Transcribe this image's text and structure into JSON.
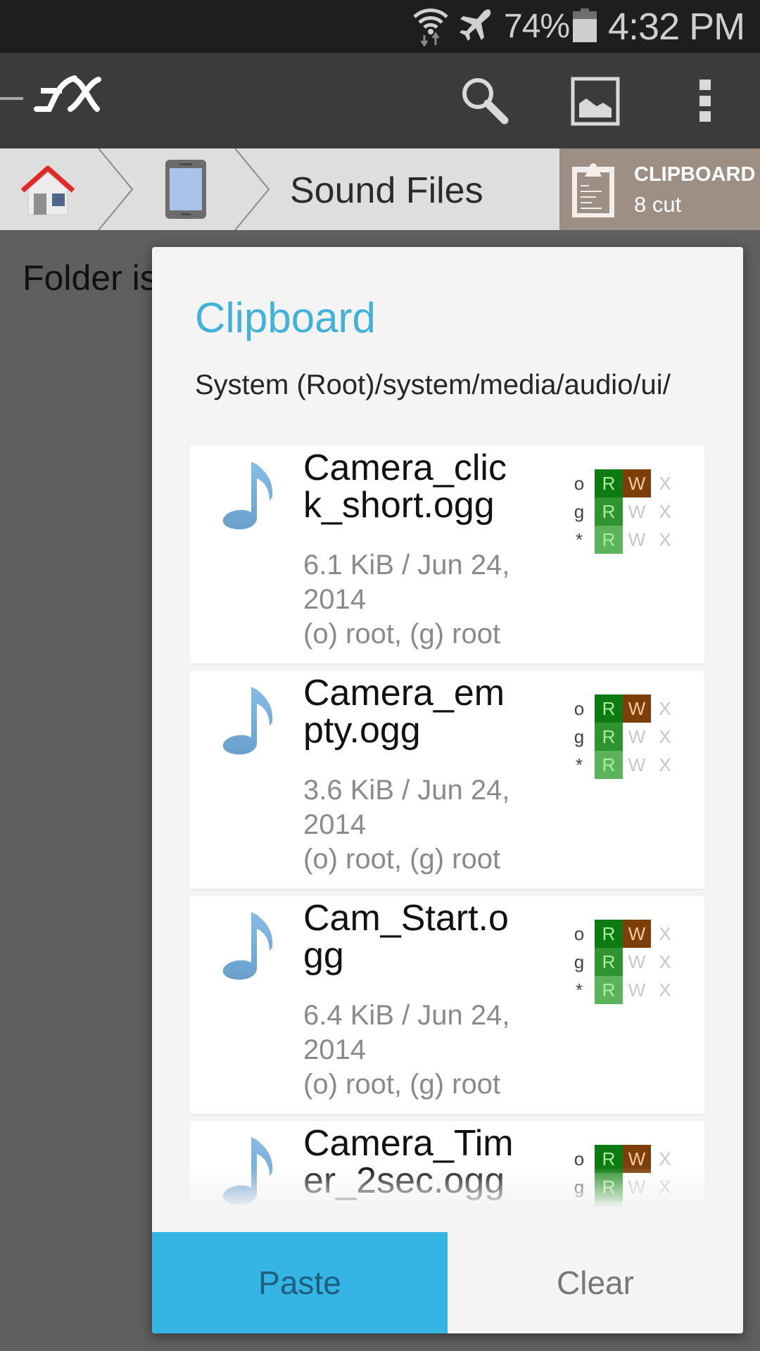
{
  "status_bar": {
    "battery_percent": "74%",
    "battery_level": 0.74,
    "time": "4:32 PM",
    "icons": [
      "wifi-data-icon",
      "airplane-mode-icon",
      "battery-icon"
    ]
  },
  "toolbar": {
    "app_logo": "FX",
    "icons": [
      "up-navigation-icon",
      "search-icon",
      "image-view-icon",
      "overflow-menu-icon"
    ]
  },
  "breadcrumb": {
    "items": [
      {
        "icon": "home-icon"
      },
      {
        "icon": "device-storage-icon"
      },
      {
        "label": "Sound Files"
      }
    ],
    "clipboard": {
      "title": "CLIPBOARD",
      "count": "8 cut"
    }
  },
  "background": {
    "message": "Folder is empty"
  },
  "dialog": {
    "title": "Clipboard",
    "path": "System (Root)/system/media/audio/ui/",
    "files": [
      {
        "name": "Camera_click_short.ogg",
        "meta_size_date": "6.1 KiB / Jun 24, 2014",
        "meta_owner": "(o) root, (g) root",
        "permissions": {
          "owner": {
            "label": "o",
            "r": true,
            "w": true,
            "x": false
          },
          "group": {
            "label": "g",
            "r": true,
            "w": false,
            "x": false
          },
          "other": {
            "label": "*",
            "r": true,
            "w": false,
            "x": false
          }
        }
      },
      {
        "name": "Camera_empty.ogg",
        "meta_size_date": "3.6 KiB / Jun 24, 2014",
        "meta_owner": "(o) root, (g) root",
        "permissions": {
          "owner": {
            "label": "o",
            "r": true,
            "w": true,
            "x": false
          },
          "group": {
            "label": "g",
            "r": true,
            "w": false,
            "x": false
          },
          "other": {
            "label": "*",
            "r": true,
            "w": false,
            "x": false
          }
        }
      },
      {
        "name": "Cam_Start.ogg",
        "meta_size_date": "6.4 KiB / Jun 24, 2014",
        "meta_owner": "(o) root, (g) root",
        "permissions": {
          "owner": {
            "label": "o",
            "r": true,
            "w": true,
            "x": false
          },
          "group": {
            "label": "g",
            "r": true,
            "w": false,
            "x": false
          },
          "other": {
            "label": "*",
            "r": true,
            "w": false,
            "x": false
          }
        }
      },
      {
        "name": "Camera_Timer_2sec.ogg",
        "meta_size_date": "",
        "meta_owner": "",
        "permissions": {
          "owner": {
            "label": "o",
            "r": true,
            "w": true,
            "x": false
          },
          "group": {
            "label": "g",
            "r": true,
            "w": false,
            "x": false
          },
          "other": {
            "label": "*",
            "r": true,
            "w": false,
            "x": false
          }
        }
      }
    ],
    "perm_letters": {
      "r": "R",
      "w": "W",
      "x": "X"
    },
    "buttons": {
      "paste": "Paste",
      "clear": "Clear"
    }
  },
  "colors": {
    "accent": "#41b1d9",
    "paste_button": "#36b5e4",
    "clipboard_panel": "#9e8f84",
    "perm_owner_read": "#0e7a12",
    "perm_group_read": "#2f942f",
    "perm_other_read": "#5db35c",
    "perm_owner_write": "#7d3f0a",
    "perm_letter_on": "#a8f0a0",
    "perm_write_letter_on": "#f5c9a0"
  }
}
